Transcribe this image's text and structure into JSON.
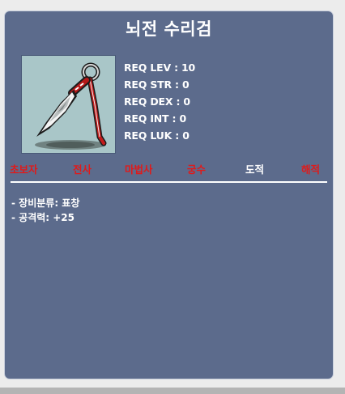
{
  "item": {
    "name": "뇌전 수리검",
    "image_icon": "throwing-star-icon"
  },
  "requirements": [
    {
      "label": "REQ LEV : 10"
    },
    {
      "label": "REQ STR : 0"
    },
    {
      "label": "REQ DEX : 0"
    },
    {
      "label": "REQ INT : 0"
    },
    {
      "label": "REQ LUK : 0"
    }
  ],
  "jobs": [
    {
      "label": "초보자",
      "allowed": false
    },
    {
      "label": "전사",
      "allowed": false
    },
    {
      "label": "마법사",
      "allowed": false
    },
    {
      "label": "궁수",
      "allowed": false
    },
    {
      "label": "도적",
      "allowed": true
    },
    {
      "label": "해적",
      "allowed": false
    }
  ],
  "stats": [
    {
      "text": "- 장비분류: 표창"
    },
    {
      "text": "- 공격력: +25"
    }
  ],
  "colors": {
    "panel_background": "#5c6b8c",
    "job_disabled": "#e01a1a",
    "job_enabled": "#ffffff",
    "image_background": "#a9c6c8"
  }
}
